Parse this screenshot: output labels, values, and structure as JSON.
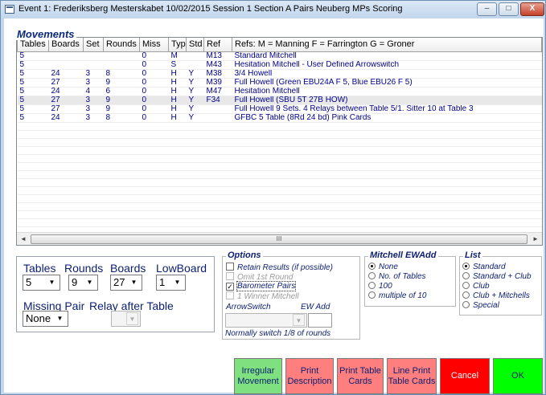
{
  "window": {
    "title": "Event 1:  Frederiksberg Mesterskabet 10/02/2015 Session 1 Section A Pairs Neuberg MPs Scoring",
    "min_symbol": "–",
    "max_symbol": "□",
    "close_symbol": "X"
  },
  "movements": {
    "group_title": "Movements",
    "columns": [
      "Tables",
      "Boards",
      "Set",
      "Rounds",
      "Miss",
      "Typ",
      "Std",
      "Ref",
      "Refs: M = Manning  F = Farrington  G = Groner"
    ],
    "rows": [
      [
        "5",
        "",
        "",
        "",
        "0",
        "M",
        "",
        "M13",
        "Standard Mitchell"
      ],
      [
        "5",
        "",
        "",
        "",
        "0",
        "S",
        "",
        "M43",
        "Hesitation Mitchell - User Defined Arrowswitch"
      ],
      [
        "5",
        "24",
        "3",
        "8",
        "0",
        "H",
        "Y",
        "M38",
        "3/4 Howell"
      ],
      [
        "5",
        "27",
        "3",
        "9",
        "0",
        "H",
        "Y",
        "M39",
        "Full Howell (Green EBU24A F 5, Blue EBU26 F 5)"
      ],
      [
        "5",
        "24",
        "4",
        "6",
        "0",
        "H",
        "Y",
        "M47",
        "Hesitation Mitchell"
      ],
      [
        "5",
        "27",
        "3",
        "9",
        "0",
        "H",
        "Y",
        "F34",
        "Full Howell (SBU 5T 27B HOW)"
      ],
      [
        "5",
        "27",
        "3",
        "9",
        "0",
        "H",
        "Y",
        "",
        "Full Howell 9 Sets. 4 Relays between Table 5/1. Sitter 10 at Table 3"
      ],
      [
        "5",
        "24",
        "3",
        "8",
        "0",
        "H",
        "Y",
        "",
        "GFBC 5 Table (8Rd 24 bd) Pink Cards"
      ]
    ],
    "selected_row": 5,
    "scroll_left": "◄",
    "scroll_right": "►",
    "scroll_thumb": "III"
  },
  "settings": {
    "tables_label": "Tables",
    "tables_value": "5",
    "rounds_label": "Rounds",
    "rounds_value": "9",
    "boards_label": "Boards",
    "boards_value": "27",
    "lowboard_label": "LowBoard",
    "lowboard_value": "1",
    "missing_pair_label": "Missing Pair",
    "missing_pair_value": "None",
    "relay_label": "Relay after Table",
    "relay_value": ""
  },
  "options": {
    "legend": "Options",
    "retain_results": "Retain Results (if possible)",
    "omit_first_round": "Omit 1st Round",
    "barometer_pairs": "Barometer Pairs",
    "winner_mitchell": "1 Winner Mitchell",
    "barometer_checked": "✓",
    "arrowswitch_label": "ArrowSwitch",
    "ew_add_label": "EW Add",
    "note": "Normally switch 1/8 of rounds"
  },
  "mitchell_ewadd": {
    "legend": "Mitchell EWAdd",
    "choices": [
      "None",
      "No. of Tables",
      "100",
      "multiple of 10"
    ],
    "selected": 0
  },
  "list": {
    "legend": "List",
    "choices": [
      "Standard",
      "Standard + Club",
      "Club",
      "Club + Mitchells",
      "Special"
    ],
    "selected": 0
  },
  "buttons": {
    "irregular": "Irregular\nMovement",
    "print_description": "Print\nDescription",
    "print_table_cards": "Print Table\nCards",
    "line_print": "Line Print\nTable Cards",
    "cancel": "Cancel",
    "ok": "OK"
  },
  "colors": {
    "irregular_bg": "#7fe07f",
    "print_bg": "#ff7f7f",
    "cancel_bg": "#ff0000",
    "ok_bg": "#00ff00"
  },
  "arrow_symbol": "▼"
}
